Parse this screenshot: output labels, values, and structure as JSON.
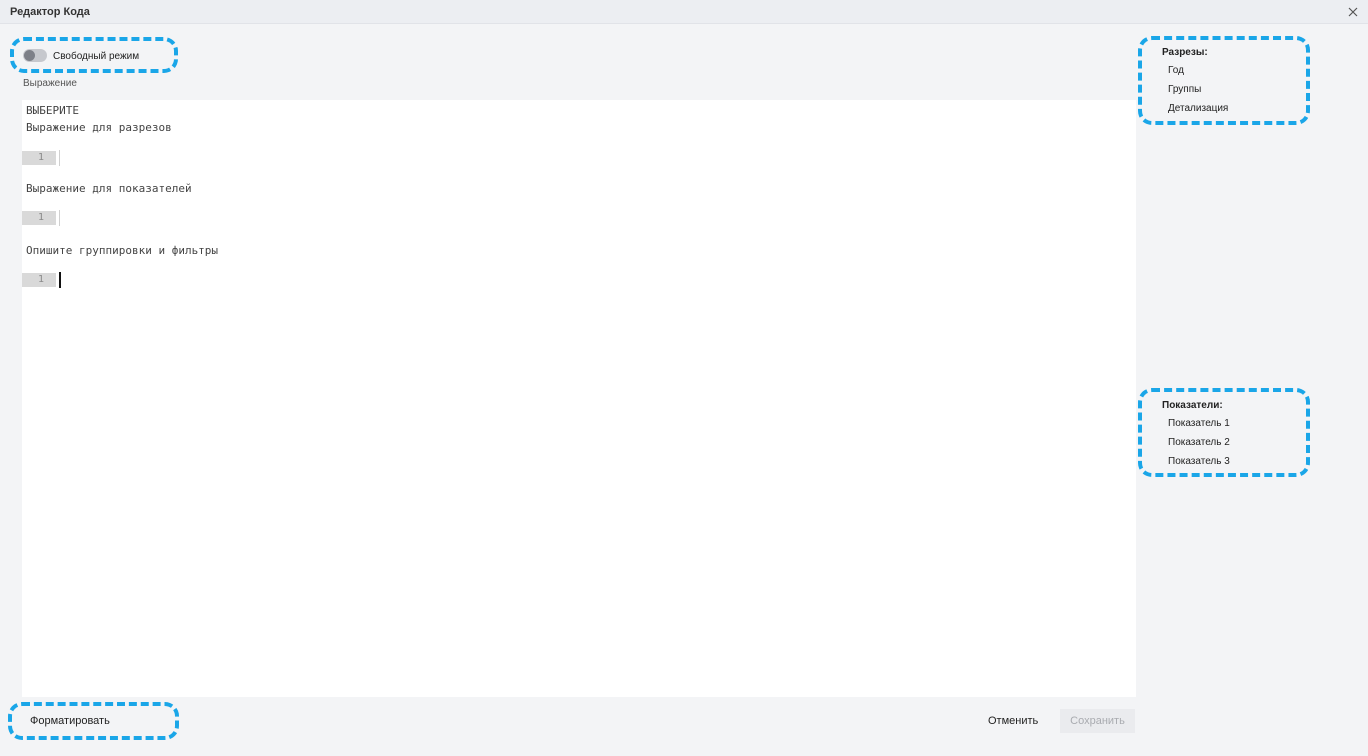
{
  "window": {
    "title": "Редактор Кода",
    "close_icon": "close-icon"
  },
  "toggle": {
    "label": "Свободный режим",
    "on": false
  },
  "expression": {
    "label": "Выражение",
    "keyword": "ВЫБЕРИТЕ",
    "sections": [
      {
        "title": "Выражение для разрезов",
        "line_number": "1",
        "value": ""
      },
      {
        "title": "Выражение для показателей",
        "line_number": "1",
        "value": ""
      },
      {
        "title": "Опишите группировки и фильтры",
        "line_number": "1",
        "value": ""
      }
    ]
  },
  "dimensions": {
    "title": "Разрезы:",
    "items": [
      "Год",
      "Группы",
      "Детализация"
    ]
  },
  "measures": {
    "title": "Показатели:",
    "items": [
      "Показатель 1",
      "Показатель 2",
      "Показатель 3"
    ]
  },
  "footer": {
    "format_label": "Форматировать",
    "cancel_label": "Отменить",
    "save_label": "Сохранить"
  },
  "colors": {
    "highlight": "#1aa6e8",
    "background": "#f3f4f6",
    "editor": "#ffffff"
  }
}
